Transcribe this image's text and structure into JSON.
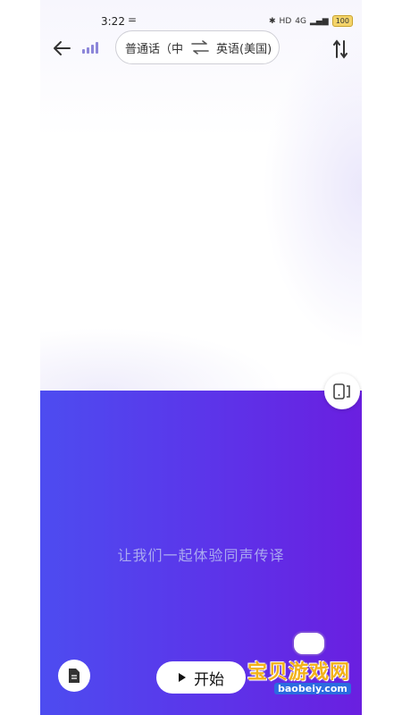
{
  "status": {
    "time": "3:22",
    "extra": "=",
    "network": "4G",
    "hd": "HD",
    "battery": "100"
  },
  "header": {
    "source_lang": "普通话（中国）",
    "target_lang": "英语(美国)"
  },
  "main": {
    "prompt": "让我们一起体验同声传译"
  },
  "footer": {
    "start_label": "开始"
  },
  "watermark": {
    "text": "宝贝游戏网",
    "url": "baobeiy.com"
  },
  "colors": {
    "accent_start": "#4d4cf0",
    "accent_end": "#6a1fe0",
    "signal": "#8c86d9"
  },
  "icons": [
    "back-arrow-icon",
    "signal-bars-icon",
    "swap-icon",
    "sort-icon",
    "layout-toggle-icon",
    "document-icon",
    "play-icon"
  ]
}
